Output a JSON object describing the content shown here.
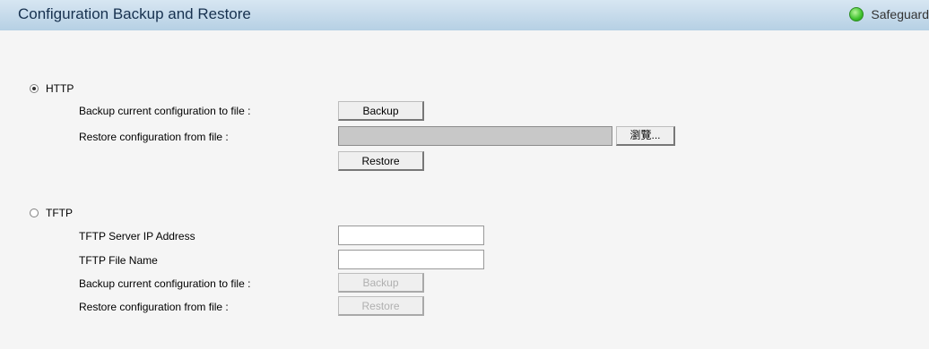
{
  "header": {
    "title": "Configuration Backup and Restore",
    "status_label": "Safeguard"
  },
  "http": {
    "option_label": "HTTP",
    "selected": true,
    "backup_label": "Backup current configuration to file :",
    "backup_button": "Backup",
    "restore_label": "Restore configuration from file :",
    "file_value": "",
    "browse_button": "瀏覽...",
    "restore_button": "Restore"
  },
  "tftp": {
    "option_label": "TFTP",
    "selected": false,
    "server_ip_label": "TFTP Server IP Address",
    "server_ip_value": "",
    "file_name_label": "TFTP File Name",
    "file_name_value": "",
    "backup_label": "Backup current configuration to file :",
    "backup_button": "Backup",
    "restore_label": "Restore configuration from file :",
    "restore_button": "Restore"
  }
}
